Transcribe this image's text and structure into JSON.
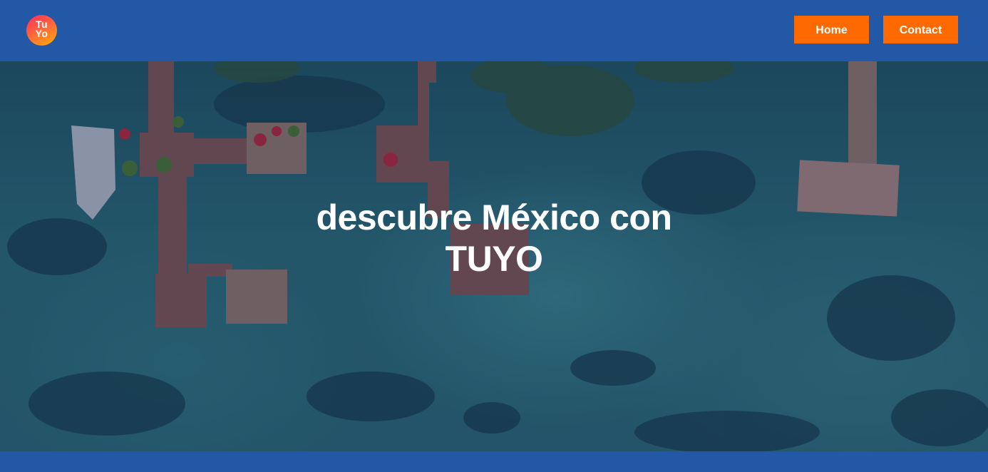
{
  "header": {
    "logo": {
      "line1": "Tu",
      "line2": "Yo"
    },
    "nav": [
      {
        "label": "Home"
      },
      {
        "label": "Contact"
      }
    ]
  },
  "hero": {
    "title": "descubre México con TUYO"
  },
  "colors": {
    "header_bg": "#2358a7",
    "button_bg": "#ff6a00",
    "button_text": "#ffffff",
    "title_text": "#ffffff"
  }
}
